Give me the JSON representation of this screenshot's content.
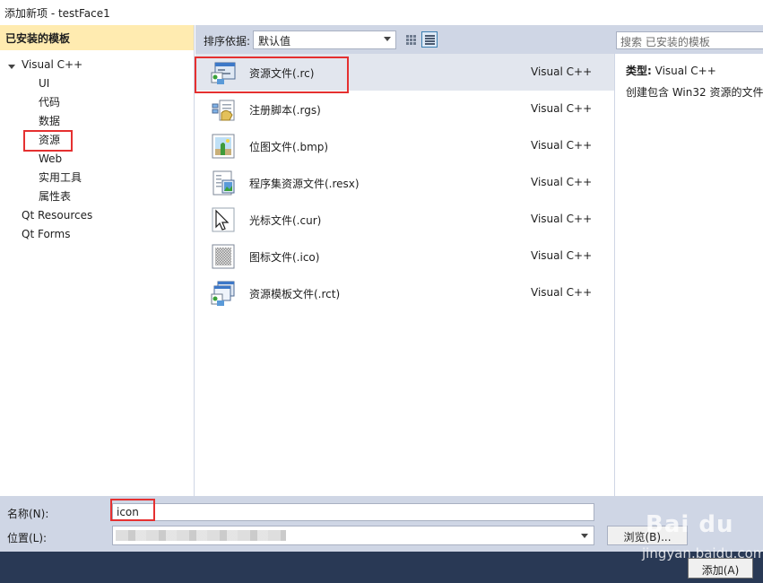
{
  "window": {
    "title": "添加新项 - testFace1"
  },
  "left": {
    "header": "已安装的模板",
    "tree": [
      {
        "label": "Visual C++",
        "level": 0,
        "expanded": true
      },
      {
        "label": "UI",
        "level": 1
      },
      {
        "label": "代码",
        "level": 1
      },
      {
        "label": "数据",
        "level": 1
      },
      {
        "label": "资源",
        "level": 1,
        "highlighted": true
      },
      {
        "label": "Web",
        "level": 1
      },
      {
        "label": "实用工具",
        "level": 1
      },
      {
        "label": "属性表",
        "level": 1
      },
      {
        "label": "Qt Resources",
        "level": 0
      },
      {
        "label": "Qt Forms",
        "level": 0
      }
    ]
  },
  "middle": {
    "sort_label": "排序依据:",
    "sort_value": "默认值",
    "view_modes": [
      "small-icons-icon",
      "list-view-icon"
    ],
    "items": [
      {
        "name": "资源文件(.rc)",
        "lang": "Visual C++",
        "icon": "resource-file-icon",
        "selected": true
      },
      {
        "name": "注册脚本(.rgs)",
        "lang": "Visual C++",
        "icon": "registry-script-icon"
      },
      {
        "name": "位图文件(.bmp)",
        "lang": "Visual C++",
        "icon": "bitmap-file-icon"
      },
      {
        "name": "程序集资源文件(.resx)",
        "lang": "Visual C++",
        "icon": "assembly-resource-icon"
      },
      {
        "name": "光标文件(.cur)",
        "lang": "Visual C++",
        "icon": "cursor-file-icon"
      },
      {
        "name": "图标文件(.ico)",
        "lang": "Visual C++",
        "icon": "icon-file-icon"
      },
      {
        "name": "资源模板文件(.rct)",
        "lang": "Visual C++",
        "icon": "resource-template-icon"
      }
    ]
  },
  "right": {
    "search_placeholder": "搜索 已安装的模板",
    "type_label": "类型:",
    "type_value": "Visual C++",
    "description": "创建包含 Win32 资源的文件"
  },
  "bottom": {
    "name_label": "名称(N):",
    "name_value": "icon",
    "location_label": "位置(L):",
    "browse_label": "浏览(B)...",
    "add_label": "添加(A)"
  },
  "watermark": {
    "logo": "Bai du",
    "url": "jingyan.baidu.com"
  },
  "colors": {
    "header_bg": "#ffebb0",
    "panel_bg": "#cfd6e5",
    "footer_bg": "#293955",
    "highlight": "#e53030",
    "selected_row": "#e2e6ee"
  }
}
